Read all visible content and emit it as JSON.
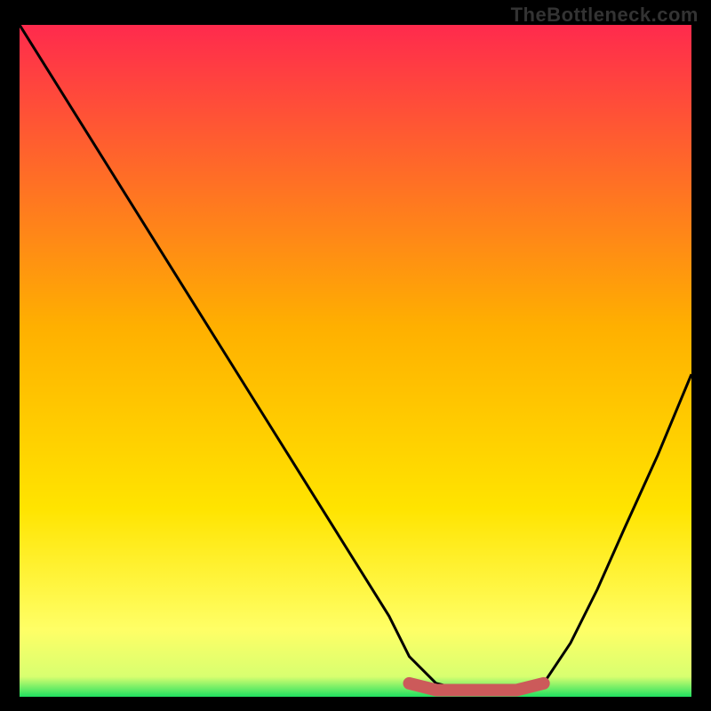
{
  "watermark": "TheBottleneck.com",
  "chart_data": {
    "type": "line",
    "title": "",
    "xlabel": "",
    "ylabel": "",
    "xlim": [
      0,
      100
    ],
    "ylim": [
      0,
      100
    ],
    "grid": false,
    "legend": false,
    "background_gradient": {
      "top": "#ff2a4d",
      "mid": "#ffd400",
      "near_bottom": "#ffff66",
      "bottom": "#20e060"
    },
    "series": [
      {
        "name": "bottleneck-curve",
        "color": "#000000",
        "x": [
          0,
          5,
          10,
          15,
          20,
          25,
          30,
          35,
          40,
          45,
          50,
          55,
          58,
          62,
          66,
          70,
          74,
          78,
          82,
          86,
          90,
          95,
          100
        ],
        "y": [
          100,
          92,
          84,
          76,
          68,
          60,
          52,
          44,
          36,
          28,
          20,
          12,
          6,
          2,
          1,
          1,
          1,
          2,
          8,
          16,
          25,
          36,
          48
        ]
      },
      {
        "name": "optimal-band-marker",
        "color": "#cc5a5a",
        "x": [
          58,
          62,
          66,
          70,
          74,
          78
        ],
        "y": [
          2,
          1,
          1,
          1,
          1,
          2
        ]
      }
    ],
    "annotations": []
  }
}
